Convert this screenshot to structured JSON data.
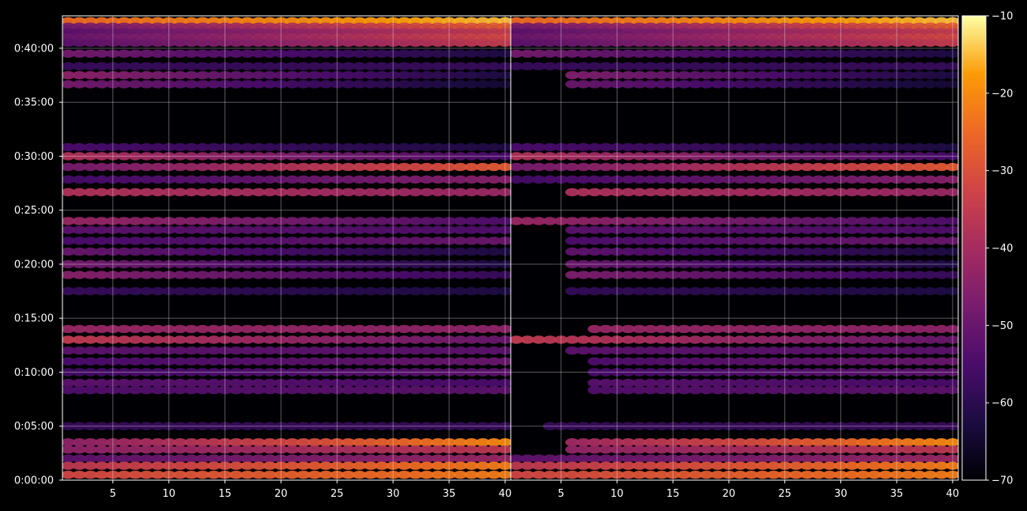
{
  "figure": {
    "background": "#000000",
    "grid_color": "#ffffff",
    "frame_color": "#ffffff"
  },
  "chart_data": {
    "type": "heatmap",
    "colormap": "inferno",
    "grid": true,
    "panels": [
      {
        "name": "",
        "xlim": [
          1,
          40
        ]
      },
      {
        "name": "",
        "xlim": [
          1,
          40
        ]
      }
    ],
    "x_ticks": [
      5,
      10,
      15,
      20,
      25,
      30,
      35,
      40
    ],
    "y_ticks": [
      "0:00:00",
      "0:05:00",
      "0:10:00",
      "0:15:00",
      "0:20:00",
      "0:25:00",
      "0:30:00",
      "0:35:00",
      "0:40:00"
    ],
    "y_tick_seconds": [
      0,
      300,
      600,
      900,
      1200,
      1500,
      1800,
      2100,
      2400
    ],
    "ylim_seconds": [
      0,
      2580
    ],
    "colorbar": {
      "range": [
        -70,
        -10
      ],
      "ticks": [
        -10,
        -20,
        -30,
        -40,
        -50,
        -60,
        -70
      ],
      "tick_labels": [
        "−10",
        "−20",
        "−30",
        "−40",
        "−50",
        "−60",
        "−70"
      ]
    },
    "bands": [
      {
        "t": 2550,
        "v": [
          -25,
          -15
        ],
        "start": 1
      },
      {
        "t": 2520,
        "v": [
          -48,
          -28
        ],
        "start": 1
      },
      {
        "t": 2490,
        "v": [
          -52,
          -35
        ],
        "start": 1
      },
      {
        "t": 2460,
        "v": [
          -50,
          -32
        ],
        "start": 1
      },
      {
        "t": 2430,
        "v": [
          -52,
          -35
        ],
        "start": 1
      },
      {
        "t": 2370,
        "v": [
          -48,
          -62
        ],
        "start": 1
      },
      {
        "t": 2300,
        "v": [
          -58,
          -58
        ],
        "start": 1
      },
      {
        "t": 2250,
        "v": [
          -44,
          -62
        ],
        "start": 6
      },
      {
        "t": 2200,
        "v": [
          -48,
          -64
        ],
        "start": 6
      },
      {
        "t": 1850,
        "v": [
          -55,
          -62
        ],
        "start": 1
      },
      {
        "t": 1800,
        "v": [
          -38,
          -55
        ],
        "start": 1
      },
      {
        "t": 1740,
        "v": [
          -48,
          -28
        ],
        "start": 1
      },
      {
        "t": 1670,
        "v": [
          -56,
          -45
        ],
        "start": 1
      },
      {
        "t": 1600,
        "v": [
          -38,
          -42
        ],
        "start": 6
      },
      {
        "t": 1440,
        "v": [
          -42,
          -54
        ],
        "start": 1
      },
      {
        "t": 1390,
        "v": [
          -52,
          -54
        ],
        "start": 6
      },
      {
        "t": 1330,
        "v": [
          -55,
          -50
        ],
        "start": 6
      },
      {
        "t": 1270,
        "v": [
          -50,
          -62
        ],
        "start": 6
      },
      {
        "t": 1200,
        "v": [
          -48,
          -62
        ],
        "start": 6
      },
      {
        "t": 1140,
        "v": [
          -45,
          -58
        ],
        "start": 6
      },
      {
        "t": 1050,
        "v": [
          -58,
          -62
        ],
        "start": 6
      },
      {
        "t": 840,
        "v": [
          -42,
          -44
        ],
        "start": 8
      },
      {
        "t": 780,
        "v": [
          -35,
          -50
        ],
        "start": 1
      },
      {
        "t": 720,
        "v": [
          -52,
          -52
        ],
        "start": 6
      },
      {
        "t": 660,
        "v": [
          -55,
          -50
        ],
        "start": 8
      },
      {
        "t": 600,
        "v": [
          -56,
          -52
        ],
        "start": 8
      },
      {
        "t": 540,
        "v": [
          -52,
          -55
        ],
        "start": 8
      },
      {
        "t": 500,
        "v": [
          -54,
          -52
        ],
        "start": 8
      },
      {
        "t": 300,
        "v": [
          -58,
          -58
        ],
        "start": 4
      },
      {
        "t": 210,
        "v": [
          -44,
          -20
        ],
        "start": 6
      },
      {
        "t": 170,
        "v": [
          -44,
          -36
        ],
        "start": 6
      },
      {
        "t": 120,
        "v": [
          -52,
          -42
        ],
        "start": 1
      },
      {
        "t": 80,
        "v": [
          -36,
          -22
        ],
        "start": 1
      },
      {
        "t": 30,
        "v": [
          -32,
          -22
        ],
        "start": 1
      }
    ]
  }
}
